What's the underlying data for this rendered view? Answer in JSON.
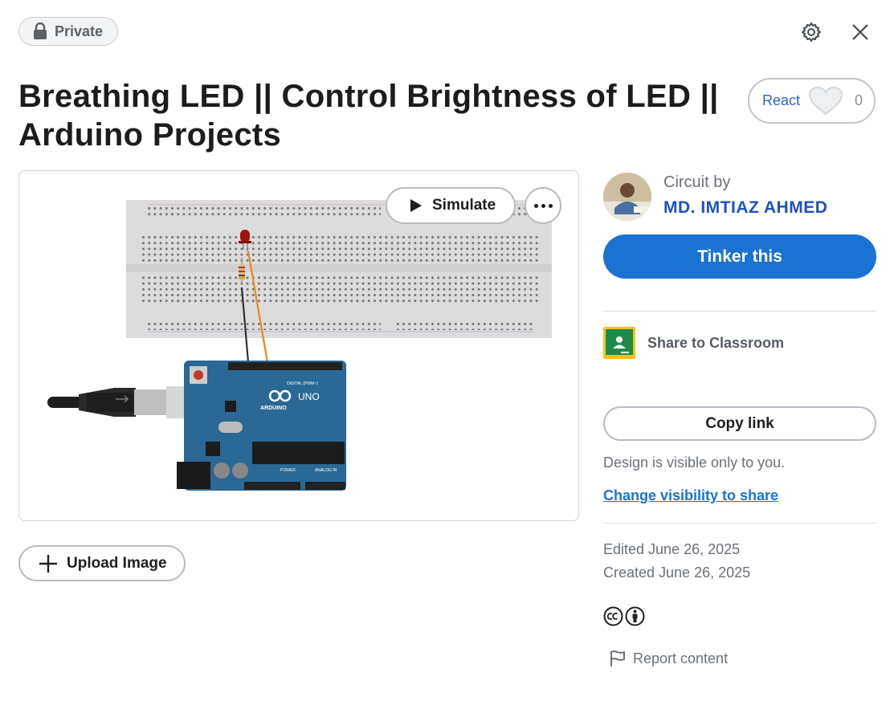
{
  "header": {
    "privacy_label": "Private",
    "settings_icon": "gear-icon",
    "close_icon": "close-icon"
  },
  "design": {
    "title": "Breathing LED || Control Brightness of LED || Arduino Projects",
    "react_label": "React",
    "react_count": "0"
  },
  "preview": {
    "simulate_label": "Simulate",
    "more_icon": "more-icon",
    "board_brand": "ARDUINO",
    "board_model": "UNO",
    "board_digital_label": "DIGITAL (PWM~)",
    "board_power_label": "POWER",
    "board_analog_label": "ANALOG IN"
  },
  "upload": {
    "label": "Upload Image"
  },
  "sidebar": {
    "circuit_by": "Circuit by",
    "author": "MD. IMTIAZ AHMED",
    "tinker_label": "Tinker this",
    "share_classroom": "Share to Classroom",
    "copy_link": "Copy link",
    "visibility_note": "Design is visible only to you.",
    "visibility_link": "Change visibility to share",
    "edited": "Edited June 26, 2025",
    "created": "Created June 26, 2025",
    "report": "Report content"
  },
  "colors": {
    "accent": "#1a73d3",
    "author": "#1c52c3",
    "board": "#2a6896",
    "wire_orange": "#e8891a"
  }
}
